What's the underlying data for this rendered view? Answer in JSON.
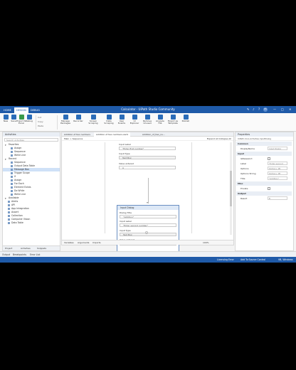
{
  "titlebar": {
    "tabs": [
      "HOME",
      "DESIGN",
      "DEBUG"
    ],
    "title": "Calculator - UiPath Studio Community",
    "user_initials": "RS"
  },
  "ribbon": {
    "buttons": [
      "New",
      "Save",
      "Export to Excel",
      "Debug",
      "Cut",
      "Copy",
      "Paste",
      "Manage Packages",
      "Recorder",
      "Screen Scraping",
      "Data Scraping",
      "User Events",
      "UI Explorer",
      "Remove Unused",
      "Analyze File",
      "Export as Template",
      "Publish"
    ],
    "small_buttons": [
      "Cut",
      "Copy",
      "Paste"
    ]
  },
  "activities": {
    "header": "Activities",
    "search_placeholder": "Search Activities",
    "items": [
      {
        "label": "Favorites",
        "indent": 0,
        "selected": false
      },
      {
        "label": "Assign",
        "indent": 2,
        "selected": false
      },
      {
        "label": "Sequence",
        "indent": 2,
        "selected": false
      },
      {
        "label": "Write Line",
        "indent": 2,
        "selected": false
      },
      {
        "label": "Recent",
        "indent": 0,
        "selected": false
      },
      {
        "label": "Sequence",
        "indent": 2,
        "selected": false
      },
      {
        "label": "Output Data Table",
        "indent": 2,
        "selected": false
      },
      {
        "label": "Message Box",
        "indent": 2,
        "selected": true
      },
      {
        "label": "Trigger Scope",
        "indent": 2,
        "selected": false
      },
      {
        "label": "If",
        "indent": 2,
        "selected": false
      },
      {
        "label": "Assign",
        "indent": 2,
        "selected": false
      },
      {
        "label": "For Each",
        "indent": 2,
        "selected": false
      },
      {
        "label": "Element Exists",
        "indent": 2,
        "selected": false
      },
      {
        "label": "Do While",
        "indent": 2,
        "selected": false
      },
      {
        "label": "Write Line",
        "indent": 2,
        "selected": false
      },
      {
        "label": "Available",
        "indent": 0,
        "selected": false
      },
      {
        "label": "Alerts",
        "indent": 1,
        "selected": false
      },
      {
        "label": "API",
        "indent": 1,
        "selected": false
      },
      {
        "label": "App Integration",
        "indent": 1,
        "selected": false
      },
      {
        "label": "Assert",
        "indent": 1,
        "selected": false
      },
      {
        "label": "Collection",
        "indent": 1,
        "selected": false
      },
      {
        "label": "Computer Vision",
        "indent": 1,
        "selected": false
      },
      {
        "label": "Data Table",
        "indent": 1,
        "selected": false
      }
    ],
    "bottom_tabs": [
      "Project",
      "Activities",
      "Snippets"
    ]
  },
  "designer": {
    "tabs": [
      "Addition of two numbers",
      "Addition of two numbers.xaml",
      "Addition_of_two_nu..."
    ],
    "breadcrumb": "Main  >  Sequence",
    "crumb_right": "Expand All  Collapse All",
    "card1": {
      "input_label_title": "Input Label",
      "input_label_value": "\"Enter first number\"",
      "input_type_title": "Input Type",
      "input_type_value": "Text Box",
      "value_title": "Value entered",
      "value_value": "A"
    },
    "card2": {
      "title": "Input Dialog",
      "dialog_title_label": "Dialog Title",
      "dialog_title_value": "\"Addition\"",
      "input_label_title": "Input Label",
      "input_label_value": "\"Enter second number\"",
      "input_type_title": "Input Type",
      "input_type_value": "Text Box",
      "value_title": "Value entered",
      "value_value": "B"
    },
    "bottom_tabs": [
      "Variables",
      "Arguments",
      "Imports"
    ],
    "zoom": "100%"
  },
  "properties": {
    "header": "Properties",
    "subheader": "UiPath.Core.Activities.InputDialog",
    "rows": [
      {
        "type": "section",
        "key": "Common"
      },
      {
        "type": "field",
        "key": "DisplayName",
        "value": "Input Dialog"
      },
      {
        "type": "section",
        "key": "Input"
      },
      {
        "type": "check",
        "key": "IsPassword"
      },
      {
        "type": "field",
        "key": "Label",
        "value": "\"Enter second"
      },
      {
        "type": "field",
        "key": "Options",
        "value": "Options, Mt"
      },
      {
        "type": "field",
        "key": "Options String",
        "value": "Options, Mt"
      },
      {
        "type": "field",
        "key": "Title",
        "value": "\"Addition\""
      },
      {
        "type": "section",
        "key": "Misc"
      },
      {
        "type": "check",
        "key": "Private"
      },
      {
        "type": "section",
        "key": "Output"
      },
      {
        "type": "field",
        "key": "Result",
        "value": "B"
      }
    ]
  },
  "bottom": {
    "tabs": [
      "Output",
      "Breakpoints",
      "Error List"
    ],
    "status_left": "Licensing Error",
    "status_mid": "Add To Source Control",
    "status_right": "VB, Windows"
  }
}
